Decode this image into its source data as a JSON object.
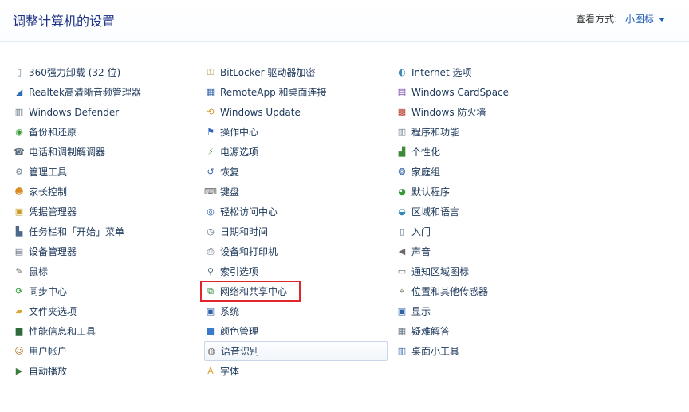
{
  "header": {
    "title": "调整计算机的设置",
    "view_by_label": "查看方式:",
    "view_by_value": "小图标"
  },
  "columns": [
    {
      "items": [
        {
          "label": "360强力卸载 (32 位)",
          "icon": "document-icon",
          "glyph": "▯",
          "color": "#6b7d90"
        },
        {
          "label": "Realtek高清晰音频管理器",
          "icon": "realtek-speaker-icon",
          "glyph": "◢",
          "color": "#2e6db6"
        },
        {
          "label": "Windows Defender",
          "icon": "defender-castle-icon",
          "glyph": "▥",
          "color": "#6c7a86"
        },
        {
          "label": "备份和还原",
          "icon": "backup-icon",
          "glyph": "◉",
          "color": "#3a9a3a"
        },
        {
          "label": "电话和调制解调器",
          "icon": "phone-modem-icon",
          "glyph": "☎",
          "color": "#5a6b7a"
        },
        {
          "label": "管理工具",
          "icon": "admin-tools-icon",
          "glyph": "⚙",
          "color": "#6d7d8d"
        },
        {
          "label": "家长控制",
          "icon": "parental-controls-icon",
          "glyph": "☻",
          "color": "#d88a22"
        },
        {
          "label": "凭据管理器",
          "icon": "credential-manager-icon",
          "glyph": "▣",
          "color": "#c79a22"
        },
        {
          "label": "任务栏和「开始」菜单",
          "icon": "taskbar-icon",
          "glyph": "▙",
          "color": "#4b6a88"
        },
        {
          "label": "设备管理器",
          "icon": "device-manager-icon",
          "glyph": "▤",
          "color": "#5b6b7b"
        },
        {
          "label": "鼠标",
          "icon": "mouse-icon",
          "glyph": "✎",
          "color": "#666666"
        },
        {
          "label": "同步中心",
          "icon": "sync-center-icon",
          "glyph": "⟳",
          "color": "#2f9a3a"
        },
        {
          "label": "文件夹选项",
          "icon": "folder-options-icon",
          "glyph": "▰",
          "color": "#d8a531"
        },
        {
          "label": "性能信息和工具",
          "icon": "performance-icon",
          "glyph": "▆",
          "color": "#2f6b3a"
        },
        {
          "label": "用户帐户",
          "icon": "user-accounts-icon",
          "glyph": "☺",
          "color": "#b2732e"
        },
        {
          "label": "自动播放",
          "icon": "autoplay-icon",
          "glyph": "▶",
          "color": "#3a7a3a"
        }
      ]
    },
    {
      "items": [
        {
          "label": "BitLocker 驱动器加密",
          "icon": "bitlocker-key-icon",
          "glyph": "⚿",
          "color": "#a88a2a"
        },
        {
          "label": "RemoteApp 和桌面连接",
          "icon": "remoteapp-icon",
          "glyph": "▦",
          "color": "#2f62a8"
        },
        {
          "label": "Windows Update",
          "icon": "windows-update-icon",
          "glyph": "⟲",
          "color": "#d0962a"
        },
        {
          "label": "操作中心",
          "icon": "action-center-flag-icon",
          "glyph": "⚑",
          "color": "#2f62b8"
        },
        {
          "label": "电源选项",
          "icon": "power-options-icon",
          "glyph": "⚡",
          "color": "#3a8a3a"
        },
        {
          "label": "恢复",
          "icon": "recovery-icon",
          "glyph": "↺",
          "color": "#2f62a8"
        },
        {
          "label": "键盘",
          "icon": "keyboard-icon",
          "glyph": "⌨",
          "color": "#5a5a5a"
        },
        {
          "label": "轻松访问中心",
          "icon": "ease-of-access-icon",
          "glyph": "◎",
          "color": "#2f62a8"
        },
        {
          "label": "日期和时间",
          "icon": "date-time-icon",
          "glyph": "◷",
          "color": "#5a6b7a"
        },
        {
          "label": "设备和打印机",
          "icon": "devices-printers-icon",
          "glyph": "⎙",
          "color": "#5a6b7a"
        },
        {
          "label": "索引选项",
          "icon": "indexing-icon",
          "glyph": "⚲",
          "color": "#5a6b7a"
        },
        {
          "label": "网络和共享中心",
          "icon": "network-sharing-icon",
          "glyph": "⧉",
          "color": "#2f8a3a"
        },
        {
          "label": "系统",
          "icon": "system-icon",
          "glyph": "▣",
          "color": "#2f62a8"
        },
        {
          "label": "颜色管理",
          "icon": "color-management-icon",
          "glyph": "■",
          "color": "#3a7ac8"
        },
        {
          "label": "语音识别",
          "icon": "microphone-icon",
          "glyph": "◍",
          "color": "#6a6a6a"
        },
        {
          "label": "字体",
          "icon": "fonts-folder-icon",
          "glyph": "A",
          "color": "#d8a531"
        }
      ]
    },
    {
      "items": [
        {
          "label": "Internet 选项",
          "icon": "internet-options-icon",
          "glyph": "◐",
          "color": "#3a8ab8"
        },
        {
          "label": "Windows CardSpace",
          "icon": "cardspace-icon",
          "glyph": "▤",
          "color": "#6a3aa8"
        },
        {
          "label": "Windows 防火墙",
          "icon": "firewall-icon",
          "glyph": "▩",
          "color": "#b83a2a"
        },
        {
          "label": "程序和功能",
          "icon": "programs-features-icon",
          "glyph": "▥",
          "color": "#6a7a8a"
        },
        {
          "label": "个性化",
          "icon": "personalization-icon",
          "glyph": "▟",
          "color": "#3a8a3a"
        },
        {
          "label": "家庭组",
          "icon": "homegroup-icon",
          "glyph": "❂",
          "color": "#2f62a8"
        },
        {
          "label": "默认程序",
          "icon": "default-programs-icon",
          "glyph": "◕",
          "color": "#3a9a3a"
        },
        {
          "label": "区域和语言",
          "icon": "region-language-icon",
          "glyph": "◒",
          "color": "#2f8ab8"
        },
        {
          "label": "入门",
          "icon": "getting-started-icon",
          "glyph": "▯",
          "color": "#6a7a8a"
        },
        {
          "label": "声音",
          "icon": "sound-icon",
          "glyph": "◀",
          "color": "#6a6a6a"
        },
        {
          "label": "通知区域图标",
          "icon": "notification-area-icon",
          "glyph": "▭",
          "color": "#5a6b7a"
        },
        {
          "label": "位置和其他传感器",
          "icon": "location-sensors-icon",
          "glyph": "⌖",
          "color": "#6a7a5a"
        },
        {
          "label": "显示",
          "icon": "display-icon",
          "glyph": "▣",
          "color": "#2f62a8"
        },
        {
          "label": "疑难解答",
          "icon": "troubleshooting-icon",
          "glyph": "▦",
          "color": "#5a6b7a"
        },
        {
          "label": "桌面小工具",
          "icon": "desktop-gadgets-icon",
          "glyph": "▥",
          "color": "#2f62a8"
        }
      ]
    }
  ]
}
